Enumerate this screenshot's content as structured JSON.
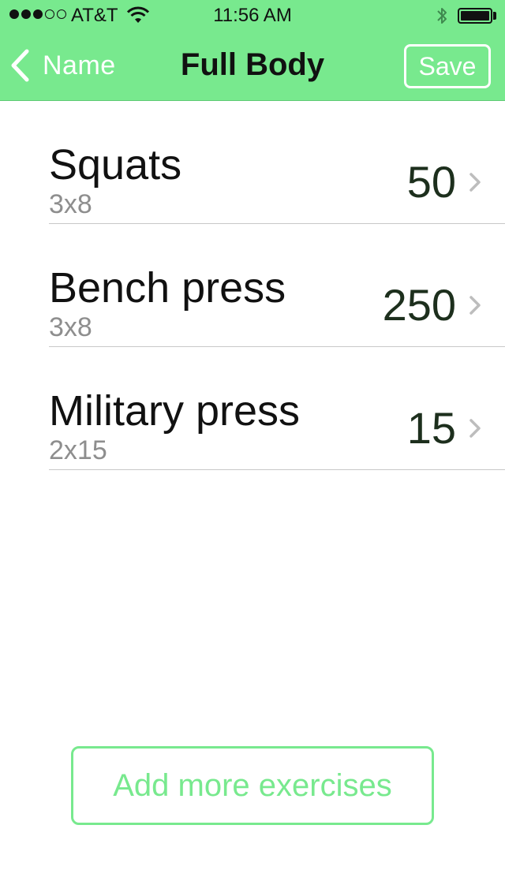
{
  "status_bar": {
    "carrier": "AT&T",
    "time": "11:56 AM",
    "signal_bars_filled": 3,
    "signal_bars_total": 5,
    "battery_level": 1.0
  },
  "nav": {
    "back_label": "Name",
    "title": "Full Body",
    "save_label": "Save"
  },
  "exercises": [
    {
      "name": "Squats",
      "sets": "3x8",
      "weight": "50"
    },
    {
      "name": "Bench press",
      "sets": "3x8",
      "weight": "250"
    },
    {
      "name": "Military press",
      "sets": "2x15",
      "weight": "15"
    }
  ],
  "add_button_label": "Add more exercises",
  "colors": {
    "accent": "#78e98e",
    "weight_text": "#1d2f1d",
    "secondary_text": "#8e8e8e"
  },
  "icons": {
    "back": "chevron-left-icon",
    "row_disclosure": "chevron-right-icon",
    "wifi": "wifi-icon",
    "bluetooth": "bluetooth-icon",
    "battery": "battery-icon"
  }
}
